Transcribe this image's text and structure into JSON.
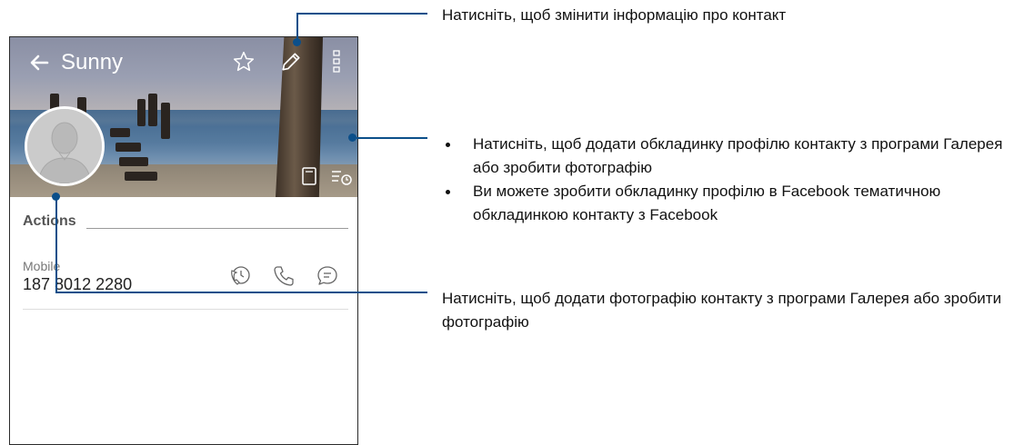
{
  "phone": {
    "title": "Sunny",
    "section_title": "Actions",
    "contact": {
      "label": "Mobile",
      "number": "187 8012 2280"
    },
    "icons": [
      "back-arrow-icon",
      "star-icon",
      "edit-pencil-icon",
      "more-options-icon",
      "contact-photo-icon",
      "cover-photo-icon",
      "history-icon",
      "call-history-icon",
      "call-icon",
      "message-icon"
    ]
  },
  "callouts": {
    "edit": "Натисніть, щоб змінити інформацію про контакт",
    "cover_bullets": [
      "Натисніть, щоб додати обкладинку профілю контакту з програми Галерея або зробити фотографію",
      "Ви можете зробити обкладинку профілю в Facebook тематичною обкладинкою контакту з Facebook"
    ],
    "photo": "Натисніть, щоб додати фотографію контакту з програми Галерея або зробити фотографію"
  },
  "colors": {
    "callout_line": "#0b4f8a",
    "text": "#111111"
  }
}
